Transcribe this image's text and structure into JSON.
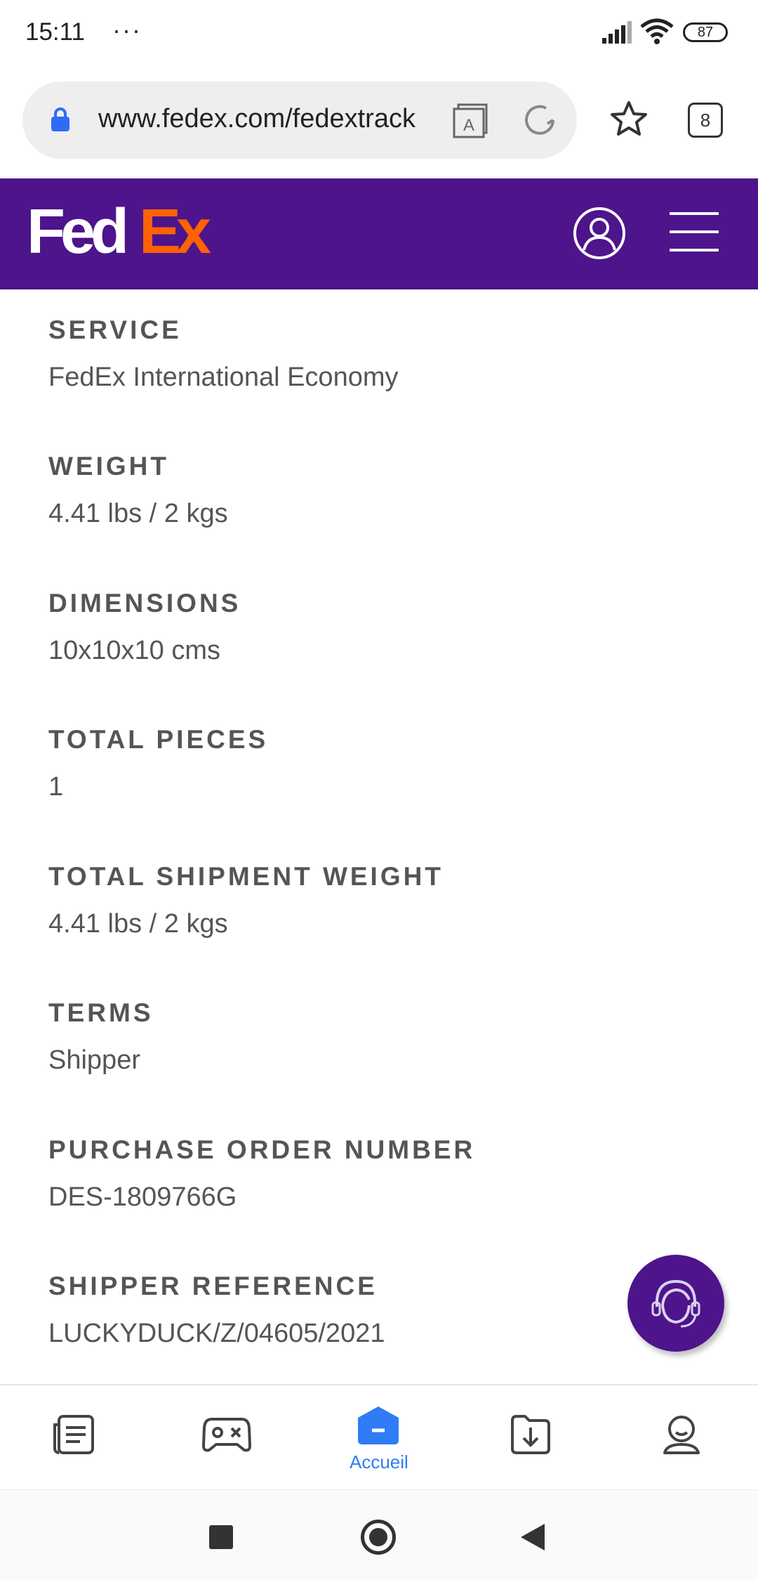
{
  "status_bar": {
    "time": "15:11",
    "overflow": "···",
    "battery": "87"
  },
  "browser": {
    "url": "www.fedex.com/fedextrack",
    "tab_count": "8",
    "icons": [
      "lock-icon",
      "reader-mode-icon",
      "reload-icon",
      "bookmark-star-icon",
      "tabs-icon"
    ]
  },
  "header": {
    "logo_fed": "Fed",
    "logo_ex": "Ex",
    "logo_reg": "®",
    "brand_purple": "#4d148c",
    "brand_orange": "#ff6200"
  },
  "details": [
    {
      "label": "SERVICE",
      "value": "FedEx International Economy"
    },
    {
      "label": "WEIGHT",
      "value": "4.41 lbs / 2 kgs"
    },
    {
      "label": "DIMENSIONS",
      "value": "10x10x10 cms"
    },
    {
      "label": "TOTAL PIECES",
      "value": "1"
    },
    {
      "label": "TOTAL SHIPMENT WEIGHT",
      "value": "4.41 lbs / 2 kgs"
    },
    {
      "label": "TERMS",
      "value": "Shipper"
    },
    {
      "label": "PURCHASE ORDER NUMBER",
      "value": "DES-1809766G"
    },
    {
      "label": "SHIPPER REFERENCE",
      "value": "LUCKYDUCK/Z/04605/2021"
    }
  ],
  "bottom_nav": {
    "home_label": "Accueil",
    "active_color": "#2f7cf6",
    "items": [
      "news-icon",
      "games-icon",
      "home-icon",
      "downloads-icon",
      "profile-icon"
    ]
  }
}
